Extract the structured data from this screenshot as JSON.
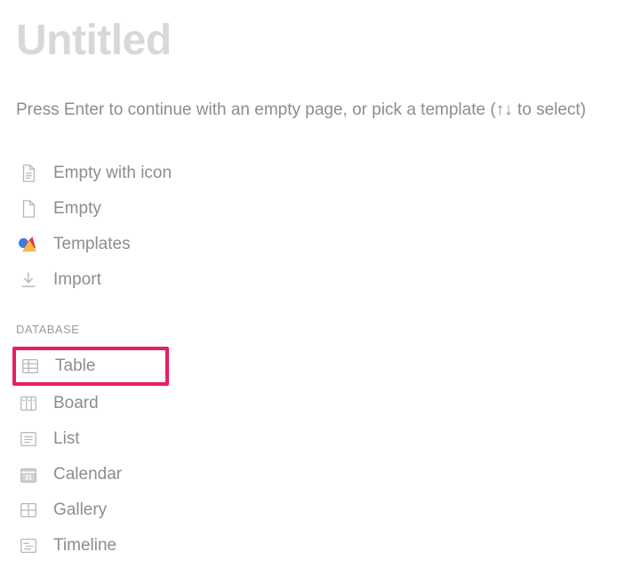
{
  "page_title": "Untitled",
  "instruction": "Press Enter to continue with an empty page, or pick a template (↑↓ to select)",
  "basic_options": [
    {
      "label": "Empty with icon"
    },
    {
      "label": "Empty"
    },
    {
      "label": "Templates"
    },
    {
      "label": "Import"
    }
  ],
  "database_header": "DATABASE",
  "database_options": [
    {
      "label": "Table",
      "highlighted": true
    },
    {
      "label": "Board"
    },
    {
      "label": "List"
    },
    {
      "label": "Calendar"
    },
    {
      "label": "Gallery"
    },
    {
      "label": "Timeline"
    }
  ]
}
